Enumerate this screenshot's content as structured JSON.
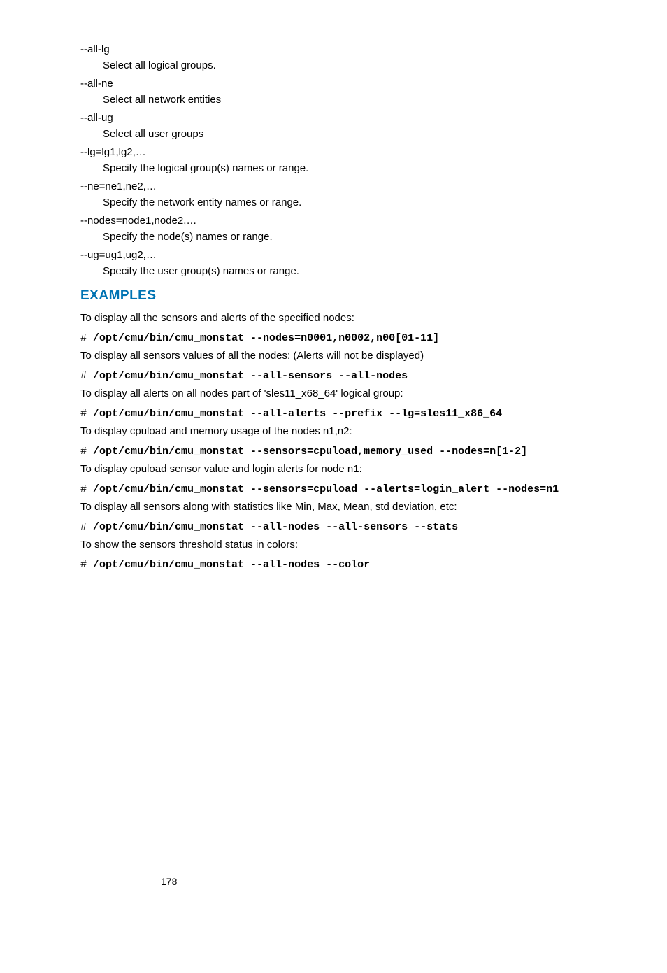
{
  "options": [
    {
      "term": "--all-lg",
      "desc": "Select all logical groups."
    },
    {
      "term": "--all-ne",
      "desc": "Select all network entities"
    },
    {
      "term": "--all-ug",
      "desc": "Select all user groups"
    },
    {
      "term": "--lg=lg1,lg2,…",
      "desc": "Specify the logical group(s) names or range."
    },
    {
      "term": "--ne=ne1,ne2,…",
      "desc": "Specify the network entity names or range."
    },
    {
      "term": "--nodes=node1,node2,…",
      "desc": "Specify the node(s) names or range."
    },
    {
      "term": "--ug=ug1,ug2,…",
      "desc": "Specify the user group(s) names or range."
    }
  ],
  "examples_heading": "EXAMPLES",
  "examples": [
    {
      "intro": "To display all the sensors and alerts of the specified nodes:",
      "prompt": "# ",
      "cmd": "/opt/cmu/bin/cmu_monstat --nodes=n0001,n0002,n00[01-11]"
    },
    {
      "intro": "To display all sensors values of all the nodes: (Alerts will not be displayed)",
      "prompt": "# ",
      "cmd": "/opt/cmu/bin/cmu_monstat --all-sensors --all-nodes"
    },
    {
      "intro": "To display all alerts on all nodes part of 'sles11_x68_64' logical group:",
      "prompt": "# ",
      "cmd": "/opt/cmu/bin/cmu_monstat --all-alerts --prefix --lg=sles11_x86_64"
    },
    {
      "intro": "To display cpuload and memory usage of the nodes n1,n2:",
      "prompt": "# ",
      "cmd": "/opt/cmu/bin/cmu_monstat --sensors=cpuload,memory_used --nodes=n[1-2]"
    },
    {
      "intro": "To display cpuload sensor value and login alerts for node n1:",
      "prompt": "# ",
      "cmd": "/opt/cmu/bin/cmu_monstat --sensors=cpuload --alerts=login_alert --nodes=n1"
    },
    {
      "intro": "To display all sensors along with statistics like Min, Max, Mean, std deviation, etc:",
      "prompt": "# ",
      "cmd": "/opt/cmu/bin/cmu_monstat --all-nodes --all-sensors --stats"
    },
    {
      "intro": "To show the sensors threshold status in colors:",
      "prompt": "# ",
      "cmd": "/opt/cmu/bin/cmu_monstat --all-nodes --color"
    }
  ],
  "page_number": "178"
}
